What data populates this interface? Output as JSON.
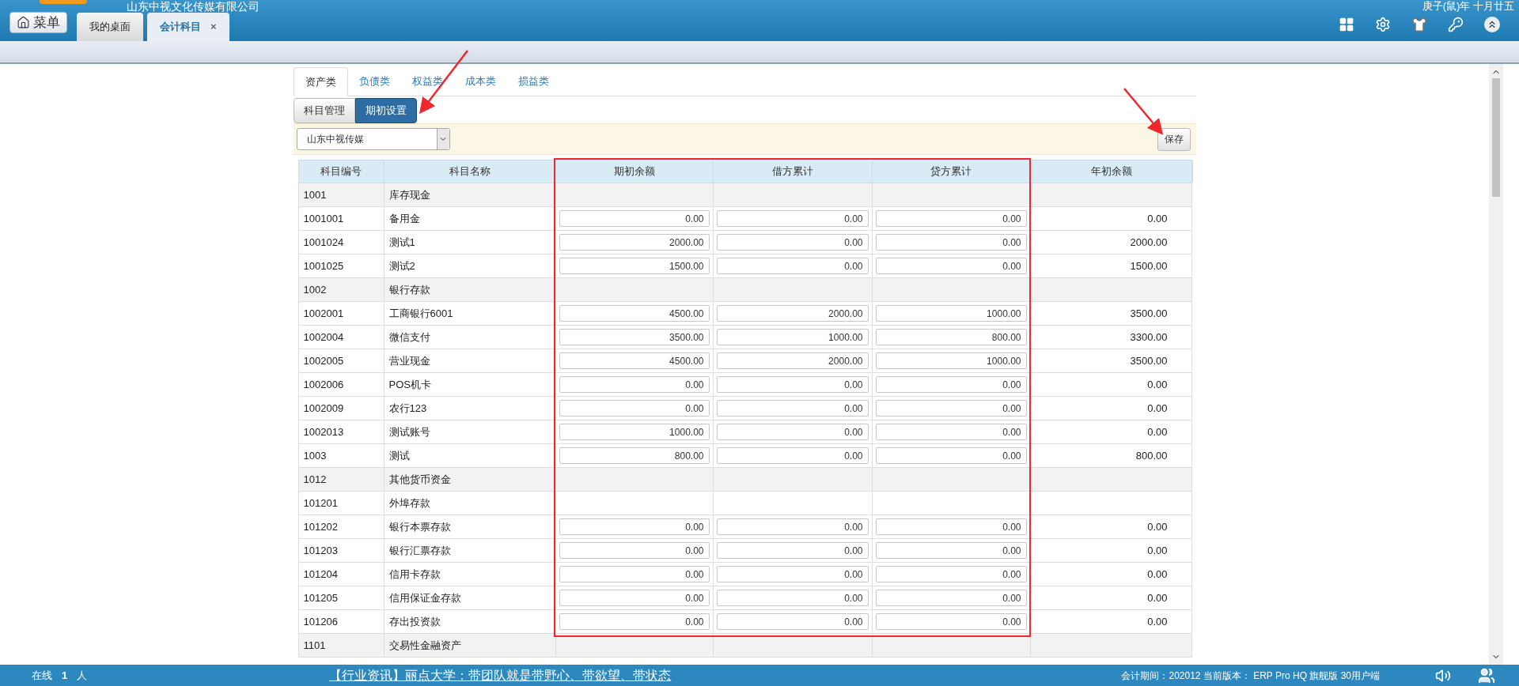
{
  "header": {
    "company": "山东中视文化传媒有限公司",
    "date": "庚子(鼠)年 十月廿五",
    "menu_button": "菜单"
  },
  "page_tabs": [
    {
      "label": "我的桌面",
      "selected": false
    },
    {
      "label": "会计科目",
      "selected": true,
      "close": "×"
    }
  ],
  "category_tabs": [
    {
      "label": "资产类",
      "selected": true
    },
    {
      "label": "负债类",
      "selected": false
    },
    {
      "label": "权益类",
      "selected": false
    },
    {
      "label": "成本类",
      "selected": false
    },
    {
      "label": "损益类",
      "selected": false
    }
  ],
  "mode_buttons": [
    {
      "label": "科目管理",
      "selected": false
    },
    {
      "label": "期初设置",
      "selected": true
    }
  ],
  "company_select": {
    "value": "山东中视传媒"
  },
  "save_button": "保存",
  "table": {
    "columns": [
      "科目编号",
      "科目名称",
      "期初余额",
      "借方累计",
      "贷方累计",
      "年初余额"
    ],
    "rows": [
      {
        "kind": "header",
        "code": "1001",
        "name": "库存现金"
      },
      {
        "kind": "entry",
        "code": "1001001",
        "name": "备用金",
        "opening": "0.00",
        "debit": "0.00",
        "credit": "0.00",
        "year_start": "0.00"
      },
      {
        "kind": "entry",
        "code": "1001024",
        "name": "测试1",
        "opening": "2000.00",
        "debit": "0.00",
        "credit": "0.00",
        "year_start": "2000.00"
      },
      {
        "kind": "entry",
        "code": "1001025",
        "name": "测试2",
        "opening": "1500.00",
        "debit": "0.00",
        "credit": "0.00",
        "year_start": "1500.00"
      },
      {
        "kind": "header",
        "code": "1002",
        "name": "银行存款"
      },
      {
        "kind": "entry",
        "code": "1002001",
        "name": "工商银行6001",
        "opening": "4500.00",
        "debit": "2000.00",
        "credit": "1000.00",
        "year_start": "3500.00"
      },
      {
        "kind": "entry",
        "code": "1002004",
        "name": "微信支付",
        "opening": "3500.00",
        "debit": "1000.00",
        "credit": "800.00",
        "year_start": "3300.00"
      },
      {
        "kind": "entry",
        "code": "1002005",
        "name": "营业现金",
        "opening": "4500.00",
        "debit": "2000.00",
        "credit": "1000.00",
        "year_start": "3500.00"
      },
      {
        "kind": "entry",
        "code": "1002006",
        "name": "POS机卡",
        "opening": "0.00",
        "debit": "0.00",
        "credit": "0.00",
        "year_start": "0.00"
      },
      {
        "kind": "entry",
        "code": "1002009",
        "name": "农行123",
        "opening": "0.00",
        "debit": "0.00",
        "credit": "0.00",
        "year_start": "0.00"
      },
      {
        "kind": "entry",
        "code": "1002013",
        "name": "测试账号",
        "opening": "1000.00",
        "debit": "0.00",
        "credit": "0.00",
        "year_start": "0.00"
      },
      {
        "kind": "entry",
        "code": "1003",
        "name": "测试",
        "opening": "800.00",
        "debit": "0.00",
        "credit": "0.00",
        "year_start": "800.00"
      },
      {
        "kind": "header",
        "code": "1012",
        "name": "其他货币资金"
      },
      {
        "kind": "plain",
        "code": "101201",
        "name": "外埠存款"
      },
      {
        "kind": "entry",
        "code": "101202",
        "name": "银行本票存款",
        "opening": "0.00",
        "debit": "0.00",
        "credit": "0.00",
        "year_start": "0.00"
      },
      {
        "kind": "entry",
        "code": "101203",
        "name": "银行汇票存款",
        "opening": "0.00",
        "debit": "0.00",
        "credit": "0.00",
        "year_start": "0.00"
      },
      {
        "kind": "entry",
        "code": "101204",
        "name": "信用卡存款",
        "opening": "0.00",
        "debit": "0.00",
        "credit": "0.00",
        "year_start": "0.00"
      },
      {
        "kind": "entry",
        "code": "101205",
        "name": "信用保证金存款",
        "opening": "0.00",
        "debit": "0.00",
        "credit": "0.00",
        "year_start": "0.00"
      },
      {
        "kind": "entry",
        "code": "101206",
        "name": "存出投资款",
        "opening": "0.00",
        "debit": "0.00",
        "credit": "0.00",
        "year_start": "0.00"
      },
      {
        "kind": "header",
        "code": "1101",
        "name": "交易性金融资产"
      }
    ]
  },
  "status_bar": {
    "online_label": "在线",
    "online_count": "1",
    "online_unit": "人",
    "news": "【行业资讯】丽点大学：带团队就是带野心、带欲望、带状态",
    "period": "会计期间：202012 当前版本： ERP Pro HQ 旗舰版 30用户端"
  }
}
